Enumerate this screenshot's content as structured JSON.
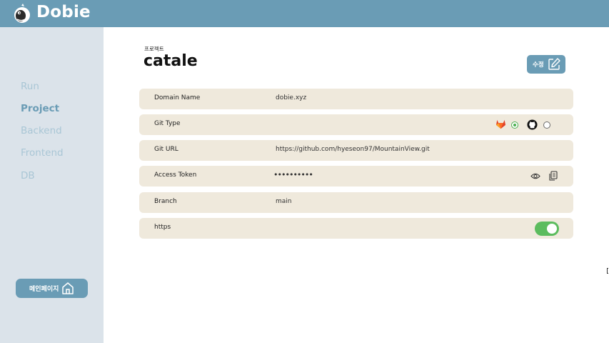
{
  "app": {
    "brand": "Dobie"
  },
  "sidebar": {
    "items": [
      {
        "label": "Run",
        "active": false
      },
      {
        "label": "Project",
        "active": true
      },
      {
        "label": "Backend",
        "active": false
      },
      {
        "label": "Frontend",
        "active": false
      },
      {
        "label": "DB",
        "active": false
      }
    ],
    "main_button_label": "메인페이지"
  },
  "page": {
    "section_label": "프로젝트",
    "title": "catale",
    "edit_label": "수정"
  },
  "fields": {
    "domain": {
      "label": "Domain Name",
      "value": "dobie.xyz"
    },
    "git_type": {
      "label": "Git Type",
      "selected": "gitlab"
    },
    "git_url": {
      "label": "Git URL",
      "value": "https://github.com/hyeseon97/MountainView.git"
    },
    "access_token": {
      "label": "Access Token",
      "masked": "••••••••••"
    },
    "branch": {
      "label": "Branch",
      "value": "main"
    },
    "https": {
      "label": "https",
      "enabled": true
    }
  },
  "colors": {
    "accent": "#6a9cb5",
    "sidebar_bg": "#dbe3ea",
    "row_bg": "#efe9dc",
    "toggle_on": "#5cbc5e"
  },
  "icons": [
    "dobie-logo-icon",
    "home-icon",
    "edit-icon",
    "gitlab-icon",
    "github-icon",
    "eye-icon",
    "copy-icon"
  ]
}
